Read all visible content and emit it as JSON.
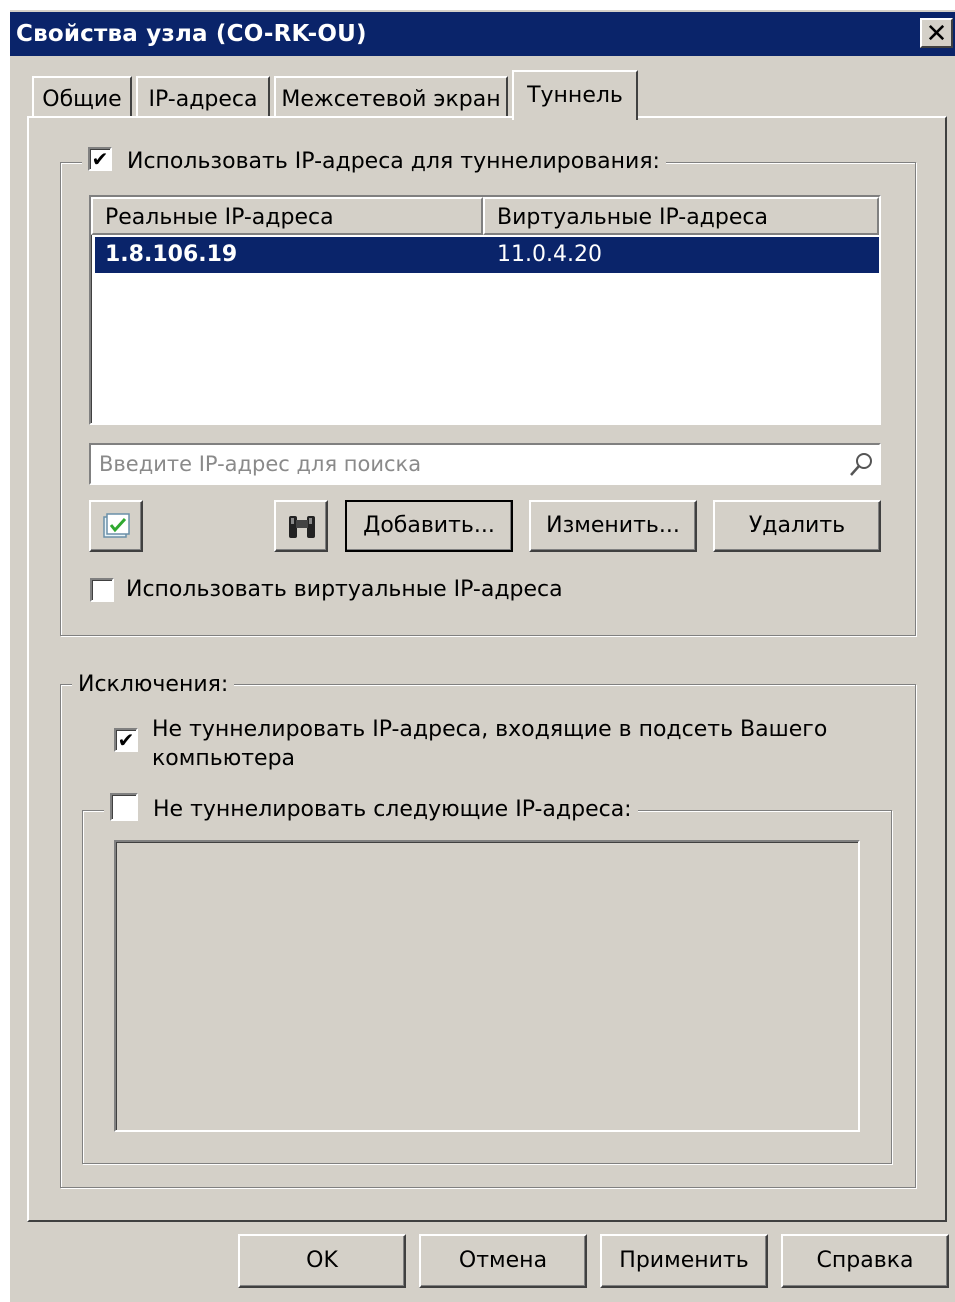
{
  "window": {
    "title": "Свойства узла (CO-RK-OU)",
    "close_glyph": "✕"
  },
  "tabs": [
    {
      "label": "Общие"
    },
    {
      "label": "IP-адреса"
    },
    {
      "label": "Межсетевой экран"
    },
    {
      "label": "Туннель",
      "active": true
    }
  ],
  "tunnel": {
    "use_ip_checkbox": {
      "label": "Использовать IP-адреса для туннелирования:",
      "checked": true,
      "glyph": "✔"
    },
    "table": {
      "columns": [
        "Реальные IP-адреса",
        "Виртуальные IP-адреса"
      ],
      "rows": [
        {
          "real": "1.8.106.19",
          "virtual": "11.0.4.20",
          "selected": true
        }
      ]
    },
    "search": {
      "placeholder": "Введите IP-адрес для поиска",
      "value": ""
    },
    "buttons": {
      "add": "Добавить...",
      "edit": "Изменить...",
      "delete": "Удалить"
    },
    "use_virtual_checkbox": {
      "label": "Использовать виртуальные IP-адреса",
      "checked": false
    }
  },
  "exclusions": {
    "title": "Исключения:",
    "subnet_checkbox": {
      "label_line1": "Не туннелировать IP-адреса, входящие в подсеть Вашего",
      "label_line2": "компьютера",
      "checked": true,
      "glyph": "✔"
    },
    "list_checkbox": {
      "label": "Не туннелировать следующие IP-адреса:",
      "checked": false
    }
  },
  "footer": {
    "ok": "OK",
    "cancel": "Отмена",
    "apply": "Применить",
    "help": "Справка"
  }
}
